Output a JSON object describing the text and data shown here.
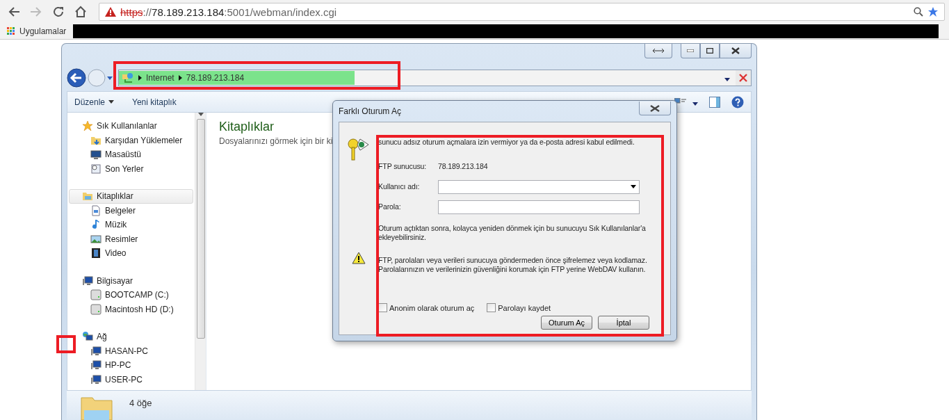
{
  "browser": {
    "url": {
      "scheme": "https",
      "separator": "://",
      "host": "78.189.213.184",
      "rest": ":5001/webman/index.cgi"
    },
    "bookmarks": {
      "apps_label": "Uygulamalar"
    }
  },
  "explorer": {
    "breadcrumb": [
      "Internet",
      "78.189.213.184"
    ],
    "progress": {
      "level": 0.39
    },
    "toolbar": [
      "Düzenle",
      "Yeni kitaplık"
    ],
    "sidebar": [
      {
        "label": "Sık Kullanılanlar",
        "selected": false,
        "children": [
          {
            "label": "Karşıdan Yüklemeler"
          },
          {
            "label": "Masaüstü"
          },
          {
            "label": "Son Yerler"
          }
        ]
      },
      {
        "label": "Kitaplıklar",
        "selected": true,
        "children": [
          {
            "label": "Belgeler"
          },
          {
            "label": "Müzik"
          },
          {
            "label": "Resimler"
          },
          {
            "label": "Video"
          }
        ]
      },
      {
        "label": "Bilgisayar",
        "selected": false,
        "children": [
          {
            "label": "BOOTCAMP (C:)"
          },
          {
            "label": "Macintosh HD (D:)"
          }
        ]
      },
      {
        "label": "Ağ",
        "selected": false,
        "children": [
          {
            "label": "HASAN-PC"
          },
          {
            "label": "HP-PC"
          },
          {
            "label": "USER-PC"
          }
        ]
      }
    ],
    "main": {
      "title": "Kitaplıklar",
      "subtitle": "Dosyalarınızı görmek için bir ki"
    },
    "status": "4 öğe"
  },
  "dialog": {
    "title": "Farklı Oturum Aç",
    "message": "sunucu adsız oturum açmalara izin vermiyor ya da e-posta adresi kabul edilmedi.",
    "server_label": "FTP sunucusu:",
    "server_value": "78.189.213.184",
    "username_label": "Kullanıcı adı:",
    "password_label": "Parola:",
    "info": "Oturum açtıktan sonra, kolayca yeniden dönmek için bu sunucuyu Sık Kullanılanlar'a ekleyebilirsiniz.",
    "warning": "FTP, parolaları veya verileri sunucuya göndermeden önce şifrelemez veya kodlamaz. Parolalarınızın ve verilerinizin güvenliğini korumak için FTP yerine WebDAV kullanın.",
    "checkboxes": [
      {
        "label": "Anonim olarak oturum aç",
        "checked": false
      },
      {
        "label": "Parolayı kaydet",
        "checked": false
      }
    ],
    "buttons": [
      "Oturum Aç",
      "İptal"
    ]
  }
}
